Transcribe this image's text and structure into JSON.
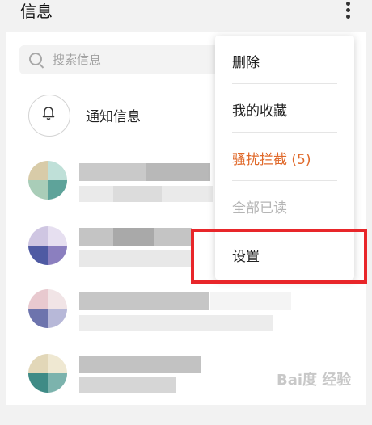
{
  "header": {
    "title": "信息",
    "menu_icon": "more-vertical-icon"
  },
  "search": {
    "placeholder": "搜索信息",
    "icon": "search-icon"
  },
  "notification": {
    "label": "通知信息",
    "icon": "bell-icon"
  },
  "conversations": [
    {
      "name": "",
      "preview": ""
    },
    {
      "name": "",
      "preview": ""
    },
    {
      "name": "",
      "preview": ""
    },
    {
      "name": "",
      "preview": ""
    }
  ],
  "menu": {
    "items": [
      {
        "label": "删除",
        "state": "normal"
      },
      {
        "label": "我的收藏",
        "state": "normal"
      },
      {
        "label": "骚扰拦截 (5)",
        "state": "warn"
      },
      {
        "label": "全部已读",
        "state": "disabled"
      },
      {
        "label": "设置",
        "state": "normal"
      }
    ]
  },
  "watermark": {
    "text": "Bai度 经验"
  },
  "colors": {
    "accent_warn": "#e0692a",
    "highlight": "#e8262a",
    "disabled": "#b5b5b5"
  }
}
